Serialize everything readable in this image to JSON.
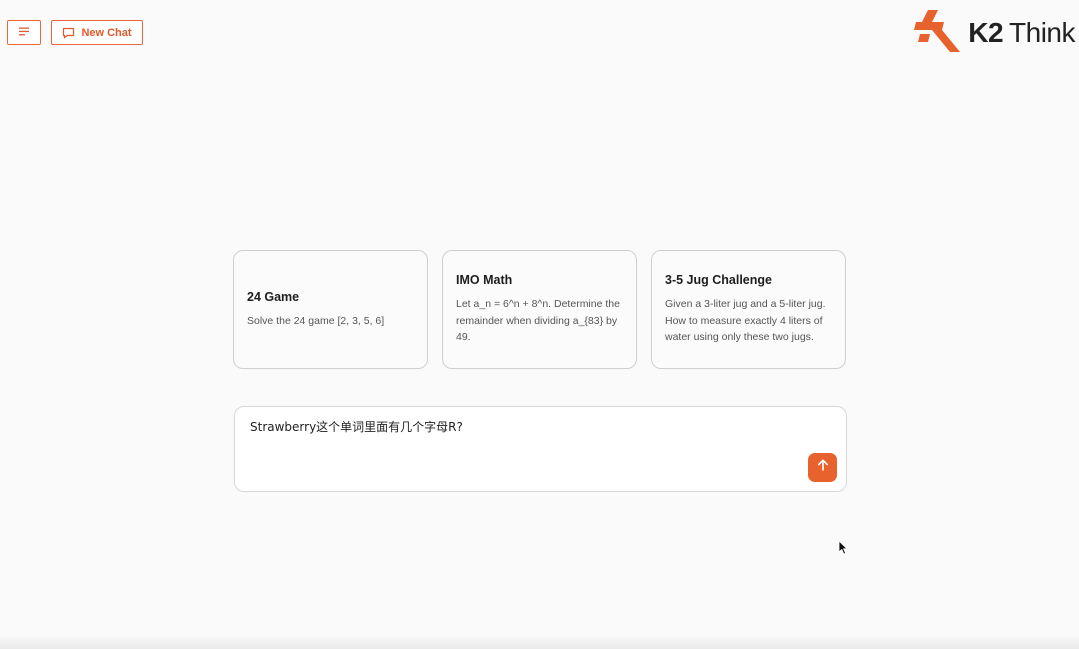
{
  "header": {
    "menu_icon": "menu-lines-icon",
    "new_chat_label": "New Chat",
    "new_chat_icon": "chat-bubble-icon"
  },
  "logo": {
    "brand_text_a": "K2",
    "brand_text_b": "Think",
    "brand_color": "#e8622e"
  },
  "suggestions": [
    {
      "title": "24 Game",
      "description": "Solve the 24 game [2, 3, 5, 6]"
    },
    {
      "title": "IMO Math",
      "description": "Let a_n = 6^n + 8^n. Determine the remainder when dividing a_{83} by 49."
    },
    {
      "title": "3-5 Jug Challenge",
      "description": "Given a 3-liter jug and a 5-liter jug. How to measure exactly 4 liters of water using only these two jugs."
    }
  ],
  "composer": {
    "value": "Strawberry这个单词里面有几个字母R?",
    "send_icon": "arrow-up-icon"
  },
  "colors": {
    "accent": "#e8622e",
    "background": "#fafafa"
  }
}
